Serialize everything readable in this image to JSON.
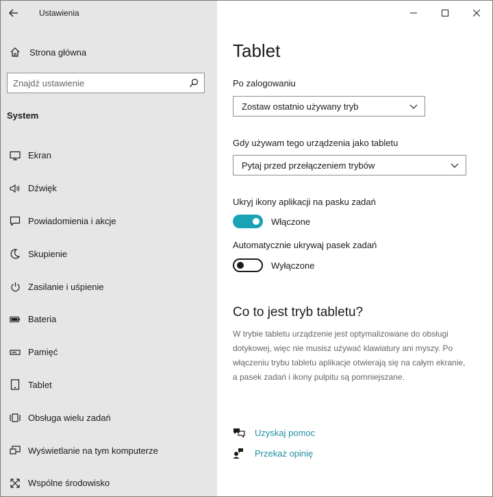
{
  "app": {
    "title": "Ustawienia"
  },
  "window_controls": {
    "minimize_icon": "minimize-icon",
    "maximize_icon": "maximize-icon",
    "close_icon": "close-icon"
  },
  "sidebar": {
    "home_label": "Strona główna",
    "search_placeholder": "Znajdź ustawienie",
    "section_title": "System",
    "items": [
      {
        "label": "Ekran",
        "icon": "monitor-icon"
      },
      {
        "label": "Dźwięk",
        "icon": "speaker-icon"
      },
      {
        "label": "Powiadomienia i akcje",
        "icon": "notification-icon"
      },
      {
        "label": "Skupienie",
        "icon": "moon-icon"
      },
      {
        "label": "Zasilanie i uśpienie",
        "icon": "power-icon"
      },
      {
        "label": "Bateria",
        "icon": "battery-icon"
      },
      {
        "label": "Pamięć",
        "icon": "storage-icon"
      },
      {
        "label": "Tablet",
        "icon": "tablet-icon"
      },
      {
        "label": "Obsługa wielu zadań",
        "icon": "multitasking-icon"
      },
      {
        "label": "Wyświetlanie na tym komputerze",
        "icon": "projecting-icon"
      },
      {
        "label": "Wspólne środowisko",
        "icon": "shared-experiences-icon"
      }
    ]
  },
  "main": {
    "title": "Tablet",
    "login_label": "Po zalogowaniu",
    "login_value": "Zostaw ostatnio używany tryb",
    "tablet_use_label": "Gdy używam tego urządzenia jako tabletu",
    "tablet_use_value": "Pytaj przed przełączeniem trybów",
    "hide_icons_label": "Ukryj ikony aplikacji na pasku zadań",
    "hide_icons_state": "Włączone",
    "auto_hide_label": "Automatycznie ukrywaj pasek zadań",
    "auto_hide_state": "Wyłączone",
    "info_heading": "Co to jest tryb tabletu?",
    "info_text": "W trybie tabletu urządzenie jest optymalizowane do obsługi dotykowej, więc nie musisz używać klawiatury ani myszy. Po włączeniu trybu tabletu aplikacje otwierają się na całym ekranie, a pasek zadań i ikony pulpitu są pomniejszane.",
    "help_link": "Uzyskaj pomoc",
    "feedback_link": "Przekaż opinię"
  },
  "colors": {
    "accent": "#1aa3b5",
    "link": "#1f8fa3",
    "sidebar_bg": "#e6e6e6"
  }
}
